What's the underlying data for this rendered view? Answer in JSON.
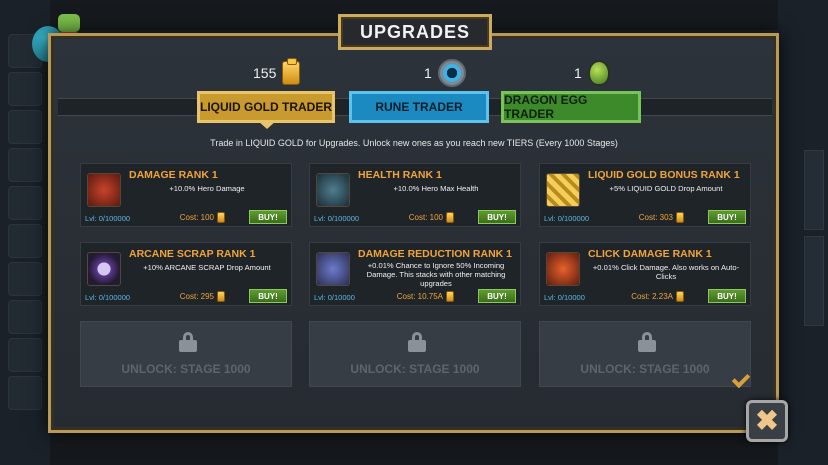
{
  "modal": {
    "title": "UPGRADES"
  },
  "currencies": {
    "liquid_gold": {
      "amount": "155",
      "icon": "gold-crate-icon"
    },
    "runes": {
      "amount": "1",
      "icon": "rune-icon"
    },
    "dragon_eggs": {
      "amount": "1",
      "icon": "dragon-egg-icon"
    }
  },
  "tabs": [
    {
      "label": "LIQUID GOLD TRADER",
      "active": true,
      "color": "#c99a2e"
    },
    {
      "label": "RUNE TRADER",
      "active": false,
      "color": "#1b8ac0"
    },
    {
      "label": "DRAGON EGG TRADER",
      "active": false,
      "color": "#3d8a2b"
    }
  ],
  "subtitle": "Trade in LIQUID GOLD for Upgrades. Unlock new ones as you reach new TIERS (Every 1000 Stages)",
  "upgrades": [
    {
      "title": "DAMAGE RANK 1",
      "desc": "+10.0% Hero Damage",
      "level": "Lvl: 0/100000",
      "cost": "Cost: 100",
      "buy": "BUY!",
      "icon": "damage-icon"
    },
    {
      "title": "HEALTH RANK 1",
      "desc": "+10.0% Hero Max Health",
      "level": "Lvl: 0/100000",
      "cost": "Cost: 100",
      "buy": "BUY!",
      "icon": "health-icon"
    },
    {
      "title": "LIQUID GOLD BONUS RANK 1",
      "desc": "+5% LIQUID GOLD Drop Amount",
      "level": "Lvl: 0/100000",
      "cost": "Cost: 303",
      "buy": "BUY!",
      "icon": "liquid-gold-icon"
    },
    {
      "title": "ARCANE SCRAP RANK 1",
      "desc": "+10% ARCANE SCRAP Drop Amount",
      "level": "Lvl: 0/100000",
      "cost": "Cost: 295",
      "buy": "BUY!",
      "icon": "arcane-scrap-icon"
    },
    {
      "title": "DAMAGE REDUCTION RANK 1",
      "desc": "+0.01% Chance to Ignore 50% Incoming Damage. This stacks with other matching upgrades",
      "level": "Lvl: 0/10000",
      "cost": "Cost: 10.75A",
      "buy": "BUY!",
      "icon": "damage-reduction-icon"
    },
    {
      "title": "CLICK DAMAGE RANK 1",
      "desc": "+0.01% Click Damage. Also works on Auto-Clicks",
      "level": "Lvl: 0/10000",
      "cost": "Cost: 2.23A",
      "buy": "BUY!",
      "icon": "click-damage-icon"
    }
  ],
  "locked": [
    {
      "label": "UNLOCK: STAGE 1000"
    },
    {
      "label": "UNLOCK: STAGE 1000"
    },
    {
      "label": "UNLOCK: STAGE 1000"
    }
  ],
  "close_label": "✖"
}
